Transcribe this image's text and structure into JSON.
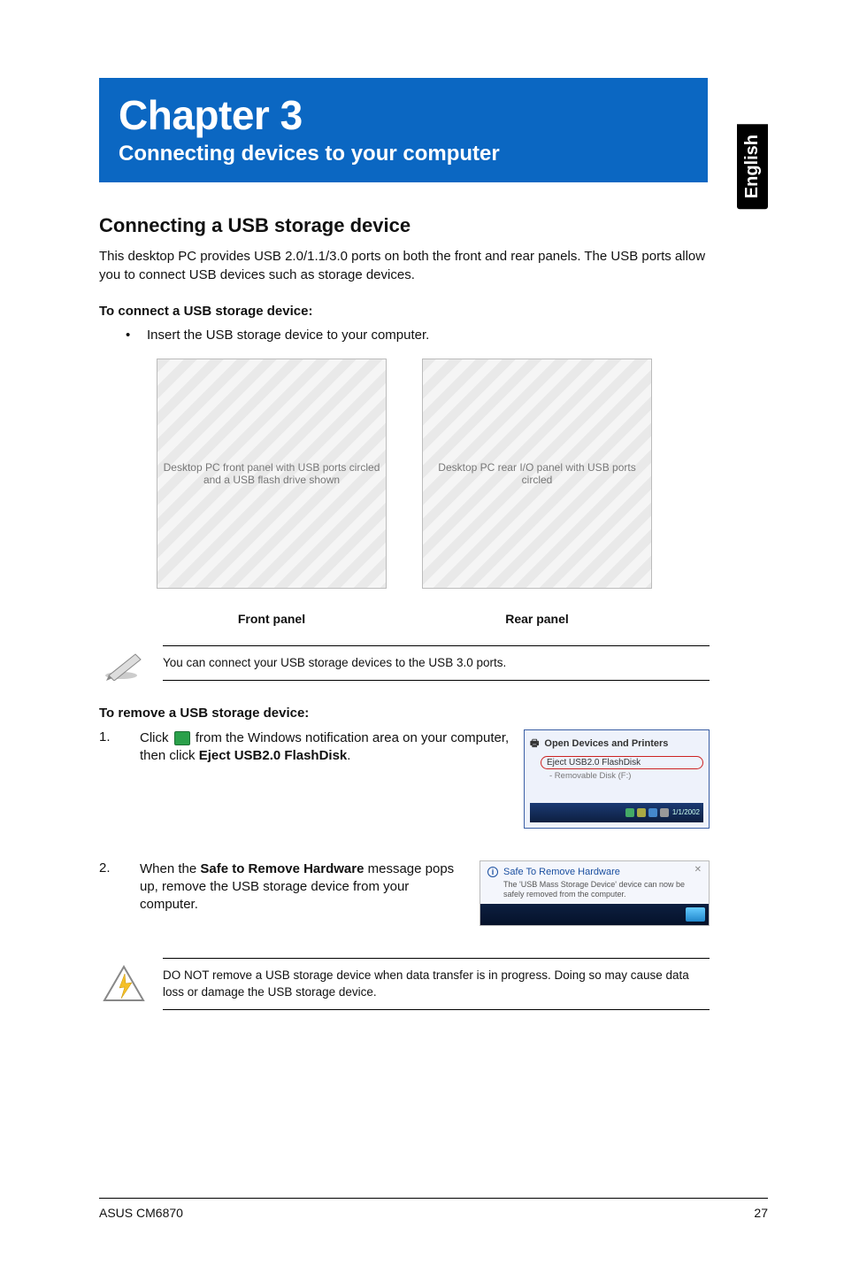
{
  "language_tab": "English",
  "chapter": {
    "number": "Chapter 3",
    "title": "Connecting devices to your computer"
  },
  "section": {
    "heading": "Connecting a USB storage device",
    "intro": "This desktop PC provides USB 2.0/1.1/3.0 ports on both the front and rear panels. The USB ports allow you to connect USB devices such as storage devices."
  },
  "connect": {
    "subhead": "To connect a USB storage device:",
    "bullet": "Insert the USB storage device to your computer."
  },
  "panels": {
    "front_caption": "Front panel",
    "rear_caption": "Rear panel",
    "front_alt": "Desktop PC front panel with USB ports circled and a USB flash drive shown",
    "rear_alt": "Desktop PC rear I/O panel with USB ports circled"
  },
  "note": {
    "text": "You can connect your USB storage devices to the USB 3.0 ports."
  },
  "remove": {
    "subhead": "To remove a USB storage device:",
    "step1_prefix": "Click ",
    "step1_mid": " from the Windows notification area on your computer, then click ",
    "step1_bold": "Eject USB2.0 FlashDisk",
    "step1_suffix": ".",
    "step2_prefix": "When the ",
    "step2_bold": "Safe to Remove Hardware",
    "step2_suffix": " message pops up, remove the USB storage device from your computer."
  },
  "screenshots": {
    "menu": {
      "open_devices": "Open Devices and Printers",
      "eject_line": "Eject USB2.0 FlashDisk",
      "removable": "- Removable Disk (F:)",
      "date": "1/1/2002"
    },
    "balloon": {
      "title": "Safe To Remove Hardware",
      "msg": "The 'USB Mass Storage Device' device can now be safely removed from the computer.",
      "close": "✕"
    }
  },
  "warning": {
    "text": "DO NOT remove a USB storage device when data transfer is in progress. Doing so may cause data loss or damage the USB storage device."
  },
  "footer": {
    "model": "ASUS CM6870",
    "page": "27"
  },
  "step_numbers": {
    "s1": "1.",
    "s2": "2."
  },
  "bullet_char": "•"
}
